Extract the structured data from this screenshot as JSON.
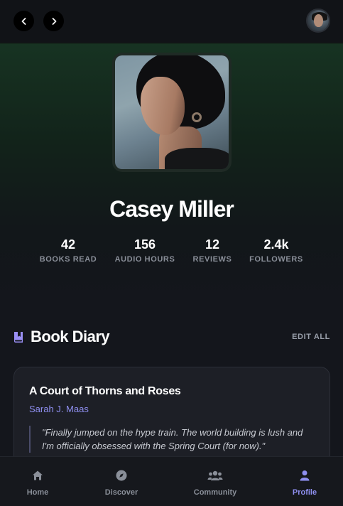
{
  "header": {
    "back_icon": "chevron-left-icon",
    "forward_icon": "chevron-right-icon",
    "avatar_icon": "user-avatar"
  },
  "profile": {
    "name": "Casey Miller",
    "stats": [
      {
        "value": "42",
        "label": "BOOKS READ"
      },
      {
        "value": "156",
        "label": "AUDIO HOURS"
      },
      {
        "value": "12",
        "label": "REVIEWS"
      },
      {
        "value": "2.4k",
        "label": "FOLLOWERS"
      }
    ]
  },
  "diary": {
    "title": "Book Diary",
    "icon": "book-bookmark-icon",
    "edit_label": "EDIT ALL",
    "entries": [
      {
        "book_title": "A Court of Thorns and Roses",
        "author": "Sarah J. Maas",
        "quote": "\"Finally jumped on the hype train. The world building is lush and I'm officially obsessed with the Spring Court (for now).\""
      }
    ]
  },
  "bottom_nav": {
    "items": [
      {
        "label": "Home",
        "icon": "home-icon",
        "active": false
      },
      {
        "label": "Discover",
        "icon": "compass-icon",
        "active": false
      },
      {
        "label": "Community",
        "icon": "users-icon",
        "active": false
      },
      {
        "label": "Profile",
        "icon": "user-icon",
        "active": true
      }
    ]
  },
  "colors": {
    "background": "#14161c",
    "accent": "#8f8ff0",
    "muted_text": "#8a8f99",
    "card": "#1d1f26"
  }
}
